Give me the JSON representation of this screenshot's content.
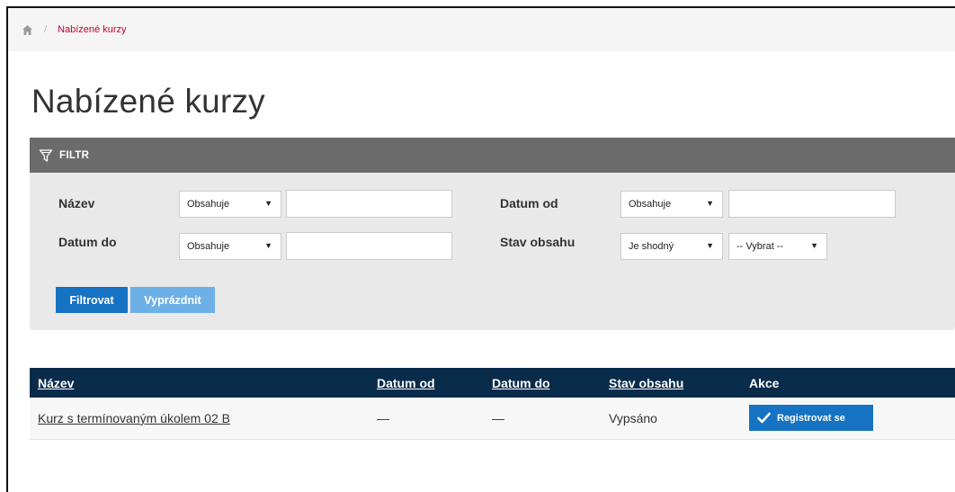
{
  "breadcrumb": {
    "home_icon": "home-icon",
    "separator": "/",
    "current": "Nabízené kurzy"
  },
  "page": {
    "title": "Nabízené kurzy"
  },
  "filter": {
    "header_icon": "filter-funnel-icon",
    "header": "FILTR",
    "fields": {
      "nazev": {
        "label": "Název",
        "operator": "Obsahuje",
        "value": ""
      },
      "datum_od": {
        "label": "Datum od",
        "operator": "Obsahuje",
        "value": ""
      },
      "datum_do": {
        "label": "Datum do",
        "operator": "Obsahuje",
        "value": ""
      },
      "stav_obsahu": {
        "label": "Stav obsahu",
        "operator": "Je shodný",
        "value": "-- Vybrat --"
      }
    },
    "apply_label": "Filtrovat",
    "clear_label": "Vyprázdnit"
  },
  "table": {
    "columns": [
      "Název",
      "Datum od",
      "Datum do",
      "Stav obsahu",
      "Akce"
    ],
    "rows": [
      {
        "name": "Kurz s termínovaným úkolem 02 B",
        "date_from": "—",
        "date_to": "—",
        "status": "Vypsáno",
        "action_label": "Registrovat se",
        "action_icon": "check-icon"
      }
    ]
  },
  "colors": {
    "accent_red": "#c3002f",
    "primary_blue": "#1672c2",
    "light_blue": "#6db0e8",
    "table_header": "#0a2c4b",
    "filter_header": "#6b6b6b",
    "filter_bg": "#e9e9e9"
  }
}
